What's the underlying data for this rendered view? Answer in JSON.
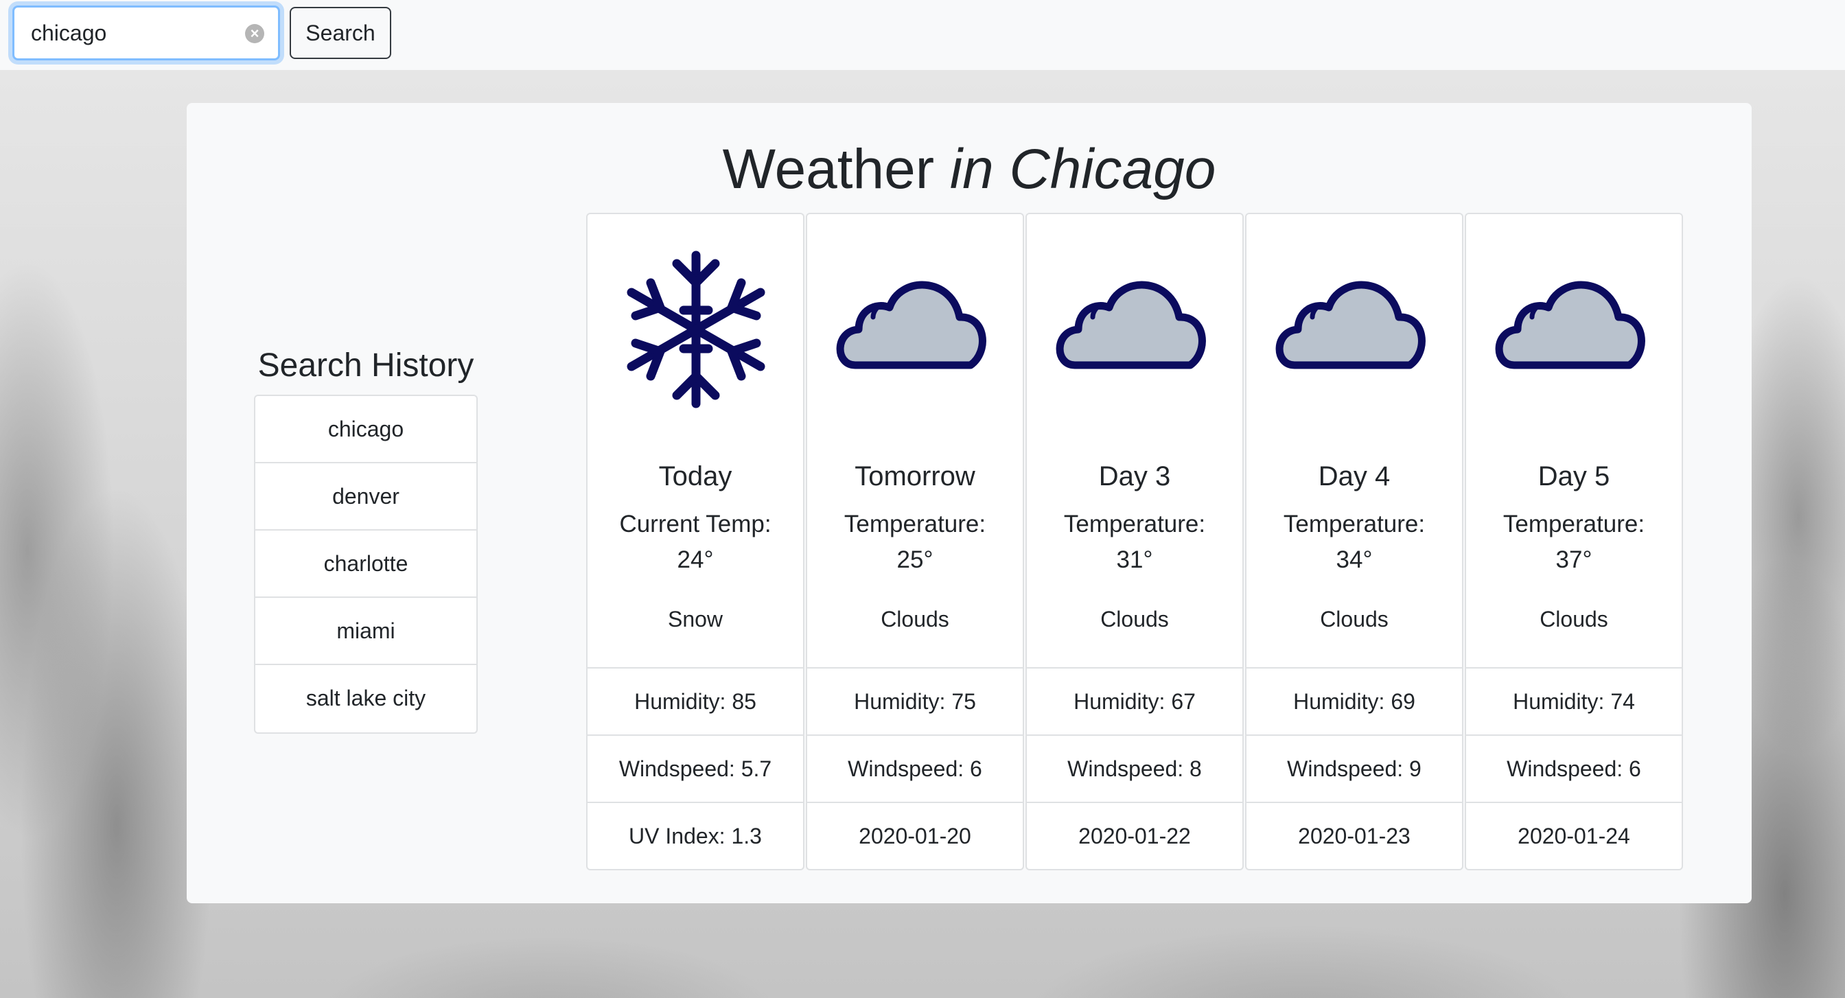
{
  "search": {
    "value": "chicago",
    "placeholder": "",
    "button_label": "Search"
  },
  "title": {
    "main": "Weather",
    "location": "in Chicago"
  },
  "history": {
    "title": "Search History",
    "items": [
      "chicago",
      "denver",
      "charlotte",
      "miami",
      "salt lake city"
    ]
  },
  "colors": {
    "icon_stroke": "#0b0b5e",
    "cloud_fill": "#b9c2cd",
    "focus": "#80bdff"
  },
  "forecast": [
    {
      "icon": "snowflake-icon",
      "day": "Today",
      "temp_label": "Current Temp:",
      "temp": "24°",
      "condition": "Snow",
      "row1": "Humidity: 85",
      "row2": "Windspeed: 5.7",
      "row3": "UV Index: 1.3"
    },
    {
      "icon": "cloud-icon",
      "day": "Tomorrow",
      "temp_label": "Temperature:",
      "temp": "25°",
      "condition": "Clouds",
      "row1": "Humidity: 75",
      "row2": "Windspeed: 6",
      "row3": "2020-01-20"
    },
    {
      "icon": "cloud-icon",
      "day": "Day 3",
      "temp_label": "Temperature:",
      "temp": "31°",
      "condition": "Clouds",
      "row1": "Humidity: 67",
      "row2": "Windspeed: 8",
      "row3": "2020-01-22"
    },
    {
      "icon": "cloud-icon",
      "day": "Day 4",
      "temp_label": "Temperature:",
      "temp": "34°",
      "condition": "Clouds",
      "row1": "Humidity: 69",
      "row2": "Windspeed: 9",
      "row3": "2020-01-23"
    },
    {
      "icon": "cloud-icon",
      "day": "Day 5",
      "temp_label": "Temperature:",
      "temp": "37°",
      "condition": "Clouds",
      "row1": "Humidity: 74",
      "row2": "Windspeed: 6",
      "row3": "2020-01-24"
    }
  ]
}
